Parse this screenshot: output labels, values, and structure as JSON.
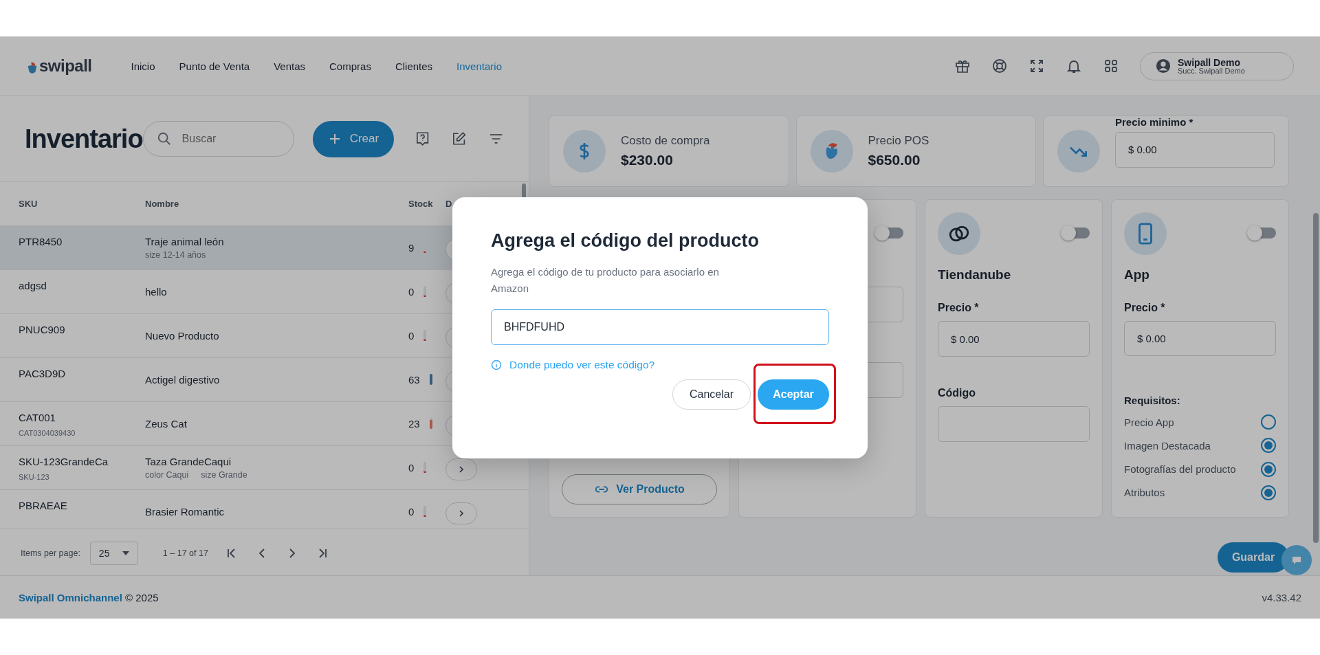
{
  "header": {
    "logo": "swipall",
    "nav": [
      {
        "label": "Inicio",
        "selected": false
      },
      {
        "label": "Punto de Venta",
        "selected": false
      },
      {
        "label": "Ventas",
        "selected": false
      },
      {
        "label": "Compras",
        "selected": false
      },
      {
        "label": "Clientes",
        "selected": false
      },
      {
        "label": "Inventario",
        "selected": true
      }
    ],
    "user": {
      "name": "Swipall Demo",
      "branch": "Succ. Swipall Demo"
    }
  },
  "inventory": {
    "title": "Inventario",
    "search": {
      "placeholder": "Buscar"
    },
    "create": "Crear",
    "columns": [
      "SKU",
      "Nombre",
      "Stock",
      "D"
    ],
    "rows": [
      {
        "sku": "PTR8450",
        "name": "Traje animal león",
        "variants": [
          "size 12-14 años"
        ],
        "stock": "9",
        "level": 0.15,
        "selected": true
      },
      {
        "sku": "adgsd",
        "name": "hello",
        "stock": "0",
        "level": 0.15,
        "selected": false
      },
      {
        "sku": "PNUC909",
        "name": "Nuevo Producto",
        "stock": "0",
        "level": 0.15,
        "selected": false
      },
      {
        "sku": "PAC3D9D",
        "name": "Actigel digestivo",
        "stock": "63",
        "level": 1,
        "selected": false
      },
      {
        "sku": "CAT001",
        "sku_sub": "CAT0304039430",
        "name": "Zeus Cat",
        "stock": "23",
        "level": 0.8,
        "selected": false
      },
      {
        "sku": "SKU-123GrandeCa",
        "sku_sub": "SKU-123",
        "name": "Taza GrandeCaqui",
        "variants": [
          "color Caqui",
          "size Grande"
        ],
        "stock": "0",
        "level": 0.15,
        "selected": false
      },
      {
        "sku": "PBRAEAE",
        "name": "Brasier Romantic",
        "stock": "0",
        "level": 0.15,
        "selected": false
      }
    ],
    "pagination": {
      "label": "Items per page:",
      "per_page": "25",
      "range": "1 – 17 of 17"
    }
  },
  "detail": {
    "stats": [
      {
        "kind": "cost",
        "label": "Costo de compra",
        "value": "$230.00"
      },
      {
        "kind": "pos",
        "label": "Precio POS",
        "value": "$650.00"
      },
      {
        "kind": "min",
        "label": "Precio minimo *",
        "value": "$  0.00"
      }
    ],
    "channels": [
      {
        "kind": "link",
        "button": "Ver Producto"
      },
      {
        "kind": "covered",
        "on": false
      },
      {
        "kind": "store",
        "name": "Tiendanube",
        "on": false,
        "price_label": "Precio *",
        "price": "$  0.00",
        "code_label": "Código"
      },
      {
        "kind": "app",
        "name": "App",
        "on": false,
        "price_label": "Precio *",
        "price": "$  0.00",
        "requirements_label": "Requisitos:",
        "requirements": [
          {
            "label": "Precio App",
            "checked": false
          },
          {
            "label": "Imagen Destacada",
            "checked": true
          },
          {
            "label": "Fotografías del producto",
            "checked": true
          },
          {
            "label": "Atributos",
            "checked": true
          }
        ]
      }
    ],
    "save": "Guardar"
  },
  "footer": {
    "brand": "Swipall Omnichannel",
    "copyright": "© 2025",
    "version": "v4.33.42"
  },
  "dialog": {
    "title": "Agrega el código del producto",
    "text": "Agrega el código de tu producto para asociarlo en Amazon",
    "value": "BHFDFUHD",
    "help": "Donde puedo ver este código?",
    "cancel": "Cancelar",
    "accept": "Aceptar",
    "accept_highlighted": true
  }
}
